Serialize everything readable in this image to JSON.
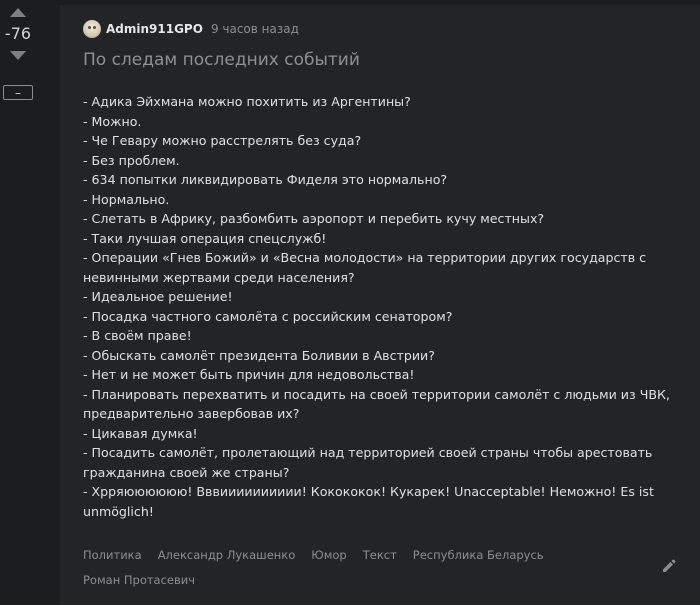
{
  "rating": {
    "score": "-76",
    "collapse_label": "–"
  },
  "story": {
    "author": "Admin911GPO",
    "time": "9 часов назад",
    "title": "По следам последних событий",
    "lines": [
      "- Адика Эйхмана можно похитить из Аргентины?",
      "- Можно.",
      "- Че Гевару можно расстрелять без суда?",
      "- Без проблем.",
      "- 634 попытки ликвидировать Фиделя это нормально?",
      "- Нормально.",
      "- Слетать в Африку, разбомбить аэропорт и перебить кучу местных?",
      "- Таки лучшая операция спецслужб!",
      "- Операции «Гнев Божий» и «Весна молодости» на территории других государств с невинными жертвами среди населения?",
      "- Идеальное решение!",
      "- Посадка частного самолёта с российским сенатором?",
      "- В своём праве!",
      "- Обыскать самолёт президента Боливии в Австрии?",
      "- Нет и не может быть причин для недовольства!",
      "- Планировать перехватить и посадить на своей территории самолёт с людьми из ЧВК, предварительно завербовав их?",
      "- Цикавая думка!",
      "- Посадить самолёт, пролетающий над территорией своей страны чтобы арестовать гражданина своей же страны?",
      "- Хрряюююююю! Вввииииииииии! Кокококок! Кукарек! Unacceptable! Неможно! Es ist unmöglich!"
    ],
    "tags": [
      "Политика",
      "Александр Лукашенко",
      "Юмор",
      "Текст",
      "Республика Беларусь",
      "Роман Протасевич"
    ]
  }
}
